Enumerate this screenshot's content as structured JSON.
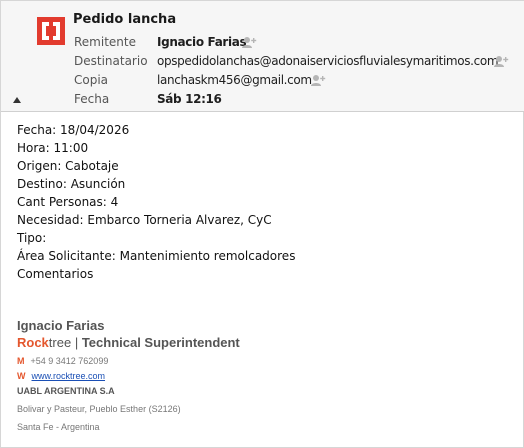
{
  "message": {
    "subject": "Pedido lancha",
    "header": {
      "from_label": "Remitente",
      "from_value": "Ignacio Farias",
      "to_label": "Destinatario",
      "to_value": "opspedidolanchas@adonaiserviciosfluvialesymaritimos.com",
      "cc_label": "Copia",
      "cc_value": "lanchaskm456@gmail.com",
      "date_label": "Fecha",
      "date_value": "Sáb 12:16"
    },
    "body_lines": [
      "Fecha: 18/04/2026",
      "Hora: 11:00",
      "Origen: Cabotaje",
      "Destino: Asunción",
      "Cant Personas: 4",
      "Necesidad: Embarco Torneria Alvarez, CyC",
      "Tipo:",
      "Área Solicitante: Mantenimiento remolcadores",
      "Comentarios"
    ]
  },
  "signature": {
    "name": "Ignacio Farias",
    "company_part1": "Rock",
    "company_part2": "tree",
    "separator": " | ",
    "title": "Technical Superintendent",
    "phone_marker": "M",
    "phone": "+54 9 3412 762099",
    "web_marker": "W",
    "website": "www.rocktree.com",
    "org": "UABL ARGENTINA S.A",
    "address1": "Bolivar y Pasteur, Pueblo Esther (S2126)",
    "address2": "Santa Fe - Argentina"
  },
  "colors": {
    "logo_red": "#e23b2e",
    "accent_orange": "#e4572e",
    "link_blue": "#1a4fb5",
    "header_bg": "#f6f6f6"
  },
  "icons": [
    "app-logo-icon",
    "add-contact-icon",
    "collapse-header-icon"
  ]
}
